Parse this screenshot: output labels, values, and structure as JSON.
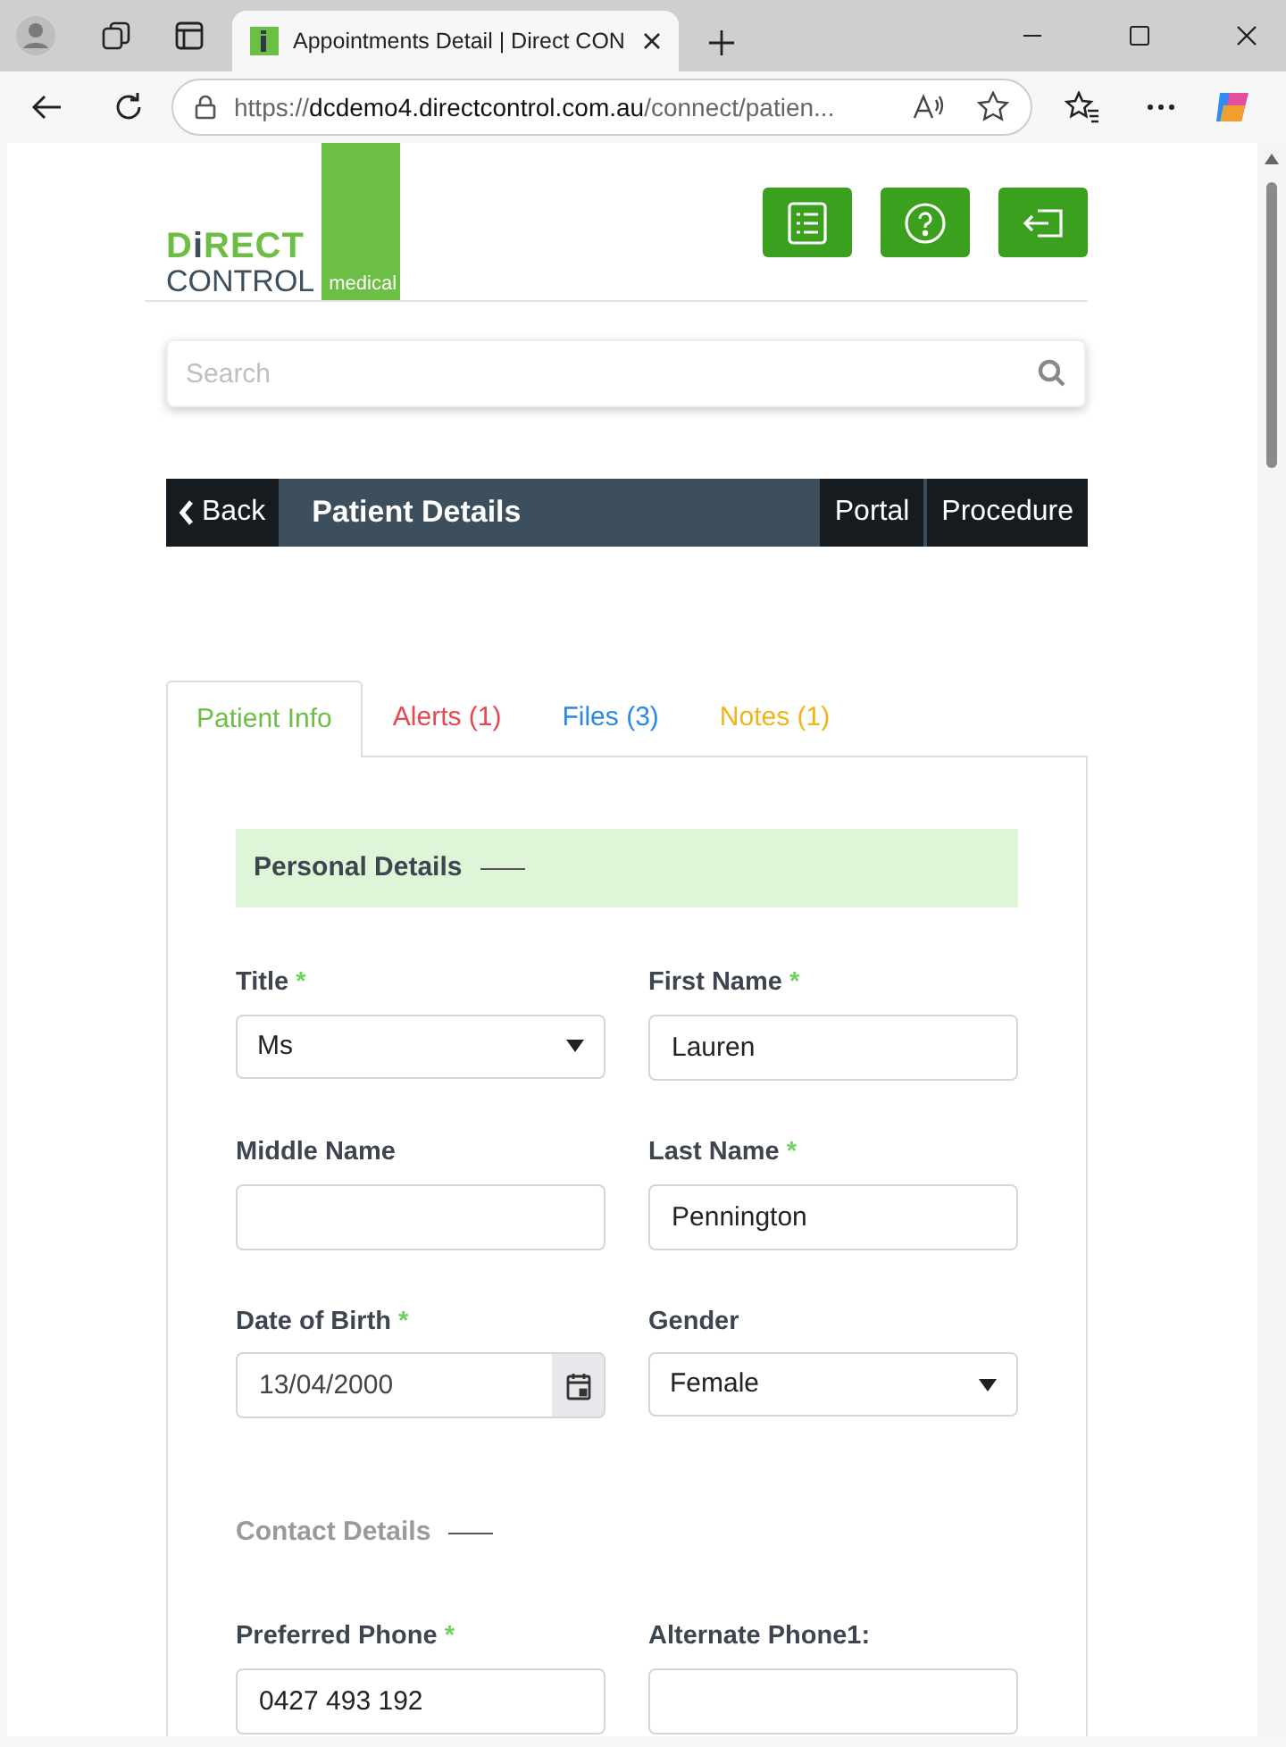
{
  "browser": {
    "tab_title": "Appointments Detail | Direct CON",
    "url_scheme": "https://",
    "url_host": "dcdemo4.directcontrol.com.au",
    "url_path": "/connect/patien..."
  },
  "logo": {
    "top_parts": [
      {
        "text": "D",
        "color": "#6dbe45"
      },
      {
        "text": "i",
        "color": "#3d4f5c"
      },
      {
        "text": "RECT",
        "color": "#6dbe45"
      }
    ],
    "bottom": "CONTROL",
    "tag": "medical"
  },
  "header_buttons": [
    {
      "kind": "list"
    },
    {
      "kind": "help"
    },
    {
      "kind": "logout"
    }
  ],
  "search": {
    "placeholder": "Search"
  },
  "title_bar": {
    "back": "Back",
    "title": "Patient Details",
    "actions": [
      "Portal",
      "Procedure"
    ]
  },
  "tabs": [
    {
      "label": "Patient Info",
      "selected": true,
      "color": "#6dbe45"
    },
    {
      "label": "Alerts (1)",
      "selected": false,
      "color": "#e8474f"
    },
    {
      "label": "Files (3)",
      "selected": false,
      "color": "#2b8ae8"
    },
    {
      "label": "Notes (1)",
      "selected": false,
      "color": "#f1b51c"
    }
  ],
  "sections": [
    {
      "title": "Personal Details",
      "kind": "band",
      "fields": [
        {
          "label": "Title",
          "required_mark": "*",
          "kind": "select",
          "value": "Ms"
        },
        {
          "label": "First Name",
          "required_mark": "*",
          "kind": "text",
          "value": "Lauren"
        },
        {
          "label": "Middle Name",
          "kind": "text"
        },
        {
          "label": "Last Name",
          "required_mark": "*",
          "kind": "text",
          "value": "Pennington"
        },
        {
          "label": "Date of Birth",
          "required_mark": "*",
          "kind": "date",
          "value": "13/04/2000"
        },
        {
          "label": "Gender",
          "kind": "select",
          "value": "Female"
        }
      ]
    },
    {
      "title": "Contact Details",
      "kind": "plain",
      "fields": [
        {
          "label": "Preferred Phone",
          "required_mark": "*",
          "kind": "text",
          "value": "0427 493 192"
        },
        {
          "label": "Alternate Phone1:",
          "kind": "text"
        }
      ]
    }
  ]
}
